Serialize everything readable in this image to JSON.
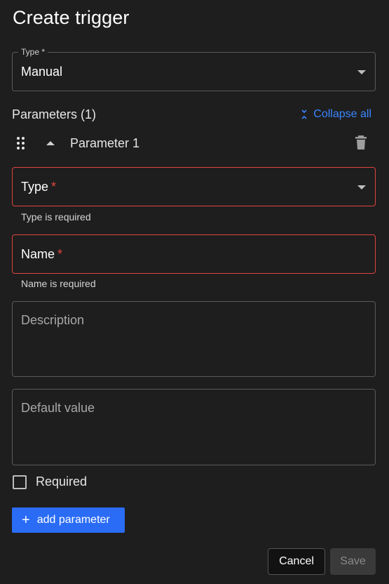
{
  "dialog": {
    "title": "Create trigger"
  },
  "type_field": {
    "label": "Type *",
    "value": "Manual"
  },
  "parameters": {
    "header": "Parameters (1)",
    "collapse_all_label": "Collapse all",
    "items": [
      {
        "name": "Parameter 1",
        "type_label": "Type",
        "type_required_mark": "*",
        "type_error": "Type is required",
        "name_label": "Name",
        "name_required_mark": "*",
        "name_error": "Name is required",
        "description_placeholder": "Description",
        "default_value_placeholder": "Default value",
        "required_label": "Required",
        "required_checked": false
      }
    ]
  },
  "actions": {
    "add_parameter_label": "add parameter",
    "cancel_label": "Cancel",
    "save_label": "Save"
  },
  "colors": {
    "background": "#1e1e1e",
    "accent": "#2a6cf6",
    "link": "#3a86ff",
    "error": "#e0443e"
  }
}
